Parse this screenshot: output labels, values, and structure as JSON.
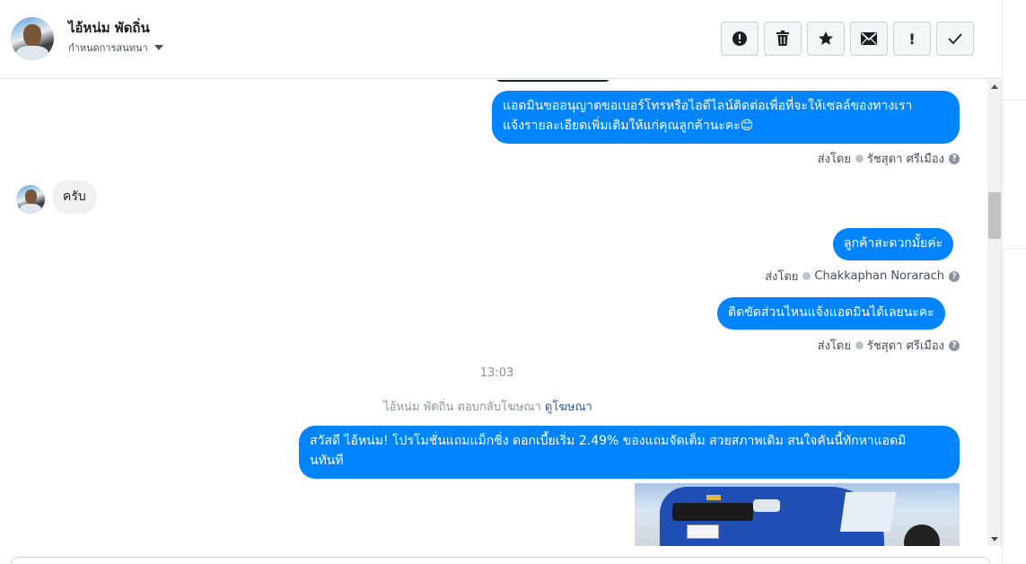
{
  "header": {
    "contact_name": "ไอ้หน่ม พัดถิ่น",
    "assign_label": "กำหนดการสนทนา",
    "toolbar": {
      "spam_icon": "exclamation-circle-icon",
      "delete_icon": "trash-icon",
      "star_icon": "star-icon",
      "unread_icon": "envelope-icon",
      "important_label": "!",
      "done_icon": "check-icon"
    }
  },
  "messages": {
    "m1": {
      "text_line1": "แอดมินขออนุญาตขอเบอร์โทรหรือไอดีไลน์ติดต่อเพื่อที่จะให้เซลล์ของทางเรา",
      "text_line2": "แจ้งรายละเอียดเพิ่มเติมให้แก่คุณลูกค้านะคะ😊",
      "sent_by_label": "ส่งโดย",
      "agent": "รัชสุดา ศรีเมือง"
    },
    "m2": {
      "text": "ครับ"
    },
    "m3": {
      "text": "ลูกค้าสะดวกมั้ยค่ะ",
      "sent_by_label": "ส่งโดย",
      "agent": "Chakkaphan Norarach"
    },
    "m4": {
      "text": "ติดขัดส่วนไหนแจ้งแอดมินได้เลยนะคะ",
      "sent_by_label": "ส่งโดย",
      "agent": "รัชสุดา ศรีเมือง"
    },
    "time_separator": "13:03",
    "ad_reply": {
      "text": "ไอ้หน่ม พัดถิ่น ตอบกลับโฆษณา",
      "link": "ดูโฆษณา"
    },
    "m5": {
      "text_line1": "สวัสดี ไอ้หน่ม! โปรโมชั่นแถมแม็กซิ่ง  ดอกเบี้ยเริ่ม 2.49% ของแถมจัดเต็ม สวยสภาพเดิม สนใจคันนี้ทักหาแอดมิ",
      "text_line2": "นทันที"
    }
  },
  "colors": {
    "outgoing_bubble": "#0084ff",
    "incoming_bubble": "#f1f0f0",
    "link": "#385898"
  }
}
